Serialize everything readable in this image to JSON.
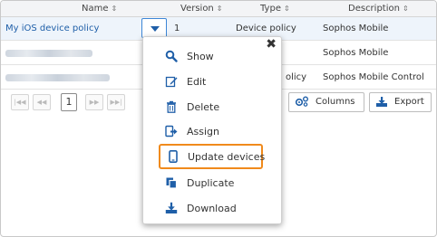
{
  "columns": {
    "name": "Name",
    "version": "Version",
    "type": "Type",
    "description": "Description",
    "sort_icon": "sort-icon"
  },
  "rows": [
    {
      "name": "My iOS device policy",
      "version": "1",
      "type": "Device policy",
      "description": "Sophos Mobile"
    },
    {
      "name": "",
      "version": "",
      "type": "",
      "description": "Sophos Mobile"
    },
    {
      "name": "",
      "version": "",
      "type": "olicy",
      "description": "Sophos Mobile Control"
    }
  ],
  "pager": {
    "first": "|◀◀",
    "prev": "◀◀",
    "page": "1",
    "next": "▶▶",
    "last": "▶▶|"
  },
  "toolbar": {
    "columns_label": "Columns",
    "export_label": "Export"
  },
  "menu": {
    "close": "✖",
    "items": [
      {
        "label": "Show",
        "icon": "search-icon"
      },
      {
        "label": "Edit",
        "icon": "edit-icon"
      },
      {
        "label": "Delete",
        "icon": "trash-icon"
      },
      {
        "label": "Assign",
        "icon": "assign-icon"
      },
      {
        "label": "Update devices",
        "icon": "mobile-device-icon"
      },
      {
        "label": "Duplicate",
        "icon": "duplicate-icon"
      },
      {
        "label": "Download",
        "icon": "download-icon"
      }
    ]
  },
  "colors": {
    "accent": "#1f5fa8",
    "highlight": "#f08a1c",
    "link": "#1f5fa8"
  }
}
